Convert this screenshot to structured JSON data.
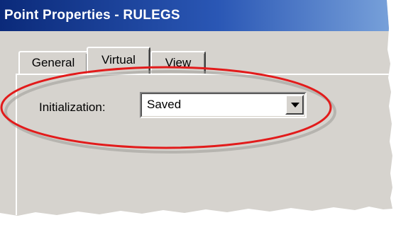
{
  "window": {
    "title": "Point Properties - RULEGS"
  },
  "tabs": [
    {
      "label": "General",
      "active": false
    },
    {
      "label": "Virtual",
      "active": true
    },
    {
      "label": "View",
      "active": false
    }
  ],
  "virtual_tab": {
    "initialization_label": "Initialization:",
    "initialization_value": "Saved"
  },
  "colors": {
    "titlebar_start": "#0b2a7a",
    "titlebar_end": "#7aa3db",
    "dialog_background": "#d6d3ce",
    "highlight_ellipse": "#e21b1b"
  },
  "icons": {
    "dropdown_arrow": "chevron-down-icon"
  }
}
